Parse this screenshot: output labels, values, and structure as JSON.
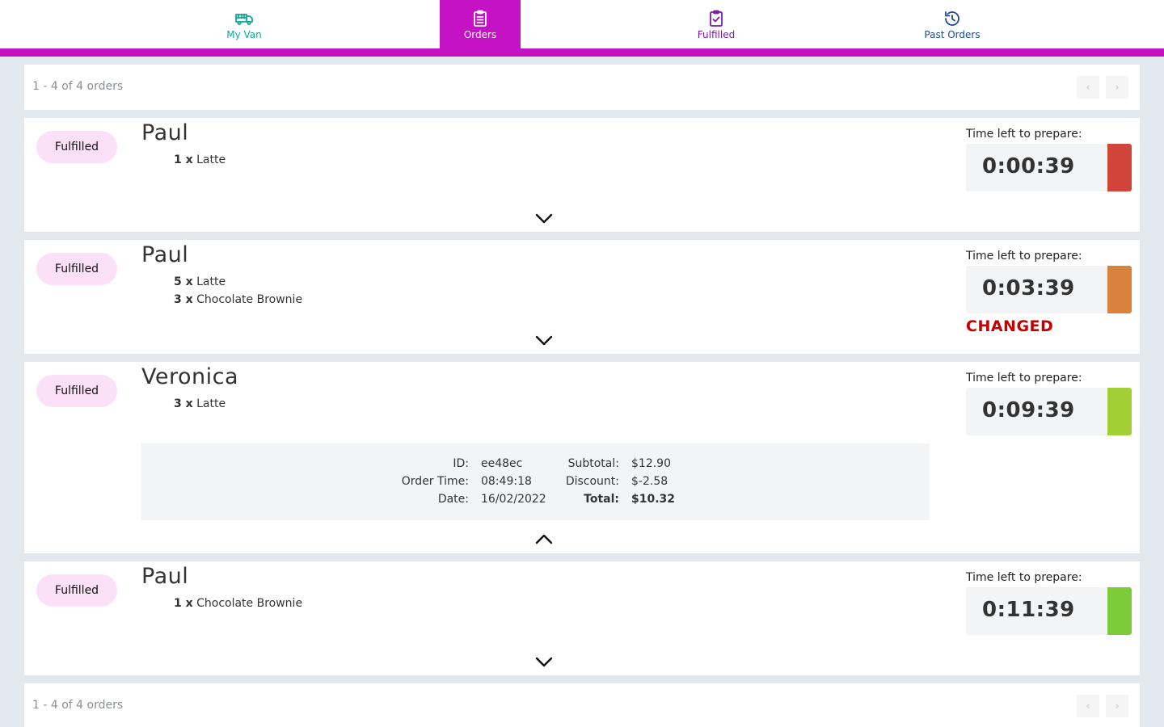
{
  "nav": {
    "tabs": [
      {
        "label": "My Van",
        "icon": "van-icon",
        "color": "#12a59a"
      },
      {
        "label": "Orders",
        "icon": "clipboard-icon",
        "active": true,
        "color": "#c512c5"
      },
      {
        "label": "Fulfilled",
        "icon": "clipboard-check-icon",
        "color": "#7a1ca6"
      },
      {
        "label": "Past Orders",
        "icon": "history-icon",
        "color": "#1b4a95"
      }
    ]
  },
  "pagination": {
    "range_text": "1 - 4 of 4 orders",
    "prev_glyph": "‹",
    "next_glyph": "›"
  },
  "prep_label": "Time left to prepare:",
  "orders": [
    {
      "status": "Fulfilled",
      "customer": "Paul",
      "items": [
        {
          "qty": "1 x",
          "name": "Latte"
        }
      ],
      "time_left": "0:00:39",
      "urgency_color": "#d0443a",
      "expanded": false
    },
    {
      "status": "Fulfilled",
      "customer": "Paul",
      "items": [
        {
          "qty": "5 x",
          "name": "Latte"
        },
        {
          "qty": "3 x",
          "name": "Chocolate Brownie"
        }
      ],
      "time_left": "0:03:39",
      "urgency_color": "#d9823b",
      "changed_label": "CHANGED",
      "expanded": false
    },
    {
      "status": "Fulfilled",
      "customer": "Veronica",
      "items": [
        {
          "qty": "3 x",
          "name": "Latte"
        }
      ],
      "time_left": "0:09:39",
      "urgency_color": "#a2cf35",
      "expanded": true,
      "details": {
        "id_label": "ID:",
        "id": "ee48ec",
        "order_time_label": "Order Time:",
        "order_time": "08:49:18",
        "date_label": "Date:",
        "date": "16/02/2022",
        "subtotal_label": "Subtotal:",
        "subtotal": "$12.90",
        "discount_label": "Discount:",
        "discount": "$-2.58",
        "total_label": "Total:",
        "total": "$10.32"
      }
    },
    {
      "status": "Fulfilled",
      "customer": "Paul",
      "items": [
        {
          "qty": "1 x",
          "name": "Chocolate Brownie"
        }
      ],
      "time_left": "0:11:39",
      "urgency_color": "#7ccc3a",
      "expanded": false
    }
  ]
}
